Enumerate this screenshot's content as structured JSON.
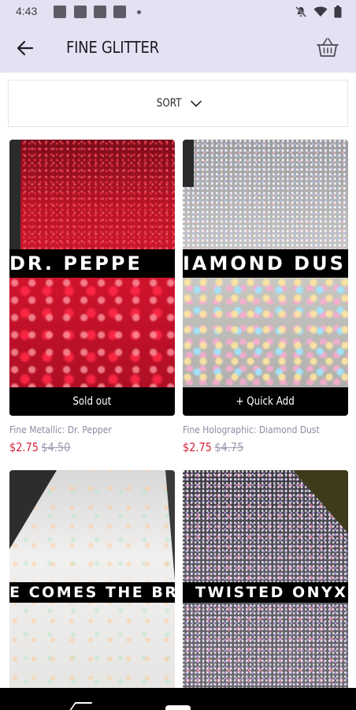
{
  "status_bar": {
    "time": "4:43"
  },
  "header": {
    "title": "FINE GLITTER",
    "back_icon": "arrow-left-icon",
    "cart_icon": "basket-icon"
  },
  "sort": {
    "label": "SORT",
    "icon": "chevron-down-icon"
  },
  "products": [
    {
      "image_text": "DR. PEPPE",
      "name": "Fine Metallic: Dr. Pepper",
      "price": "$2.75",
      "compare_price": "$4.50",
      "action": "Sold out"
    },
    {
      "image_text": "IAMOND DUS",
      "name": "Fine Holographic: Diamond Dust",
      "price": "$2.75",
      "compare_price": "$4.75",
      "action": "+ Quick Add"
    },
    {
      "image_text": "E COMES THE BR"
    },
    {
      "image_text": "TWISTED ONYX"
    }
  ],
  "colors": {
    "header_bg": "#e3e1f2",
    "sale_price": "#d6213b",
    "compare_price": "#9a9cb0",
    "product_name": "#8a8ca3"
  }
}
